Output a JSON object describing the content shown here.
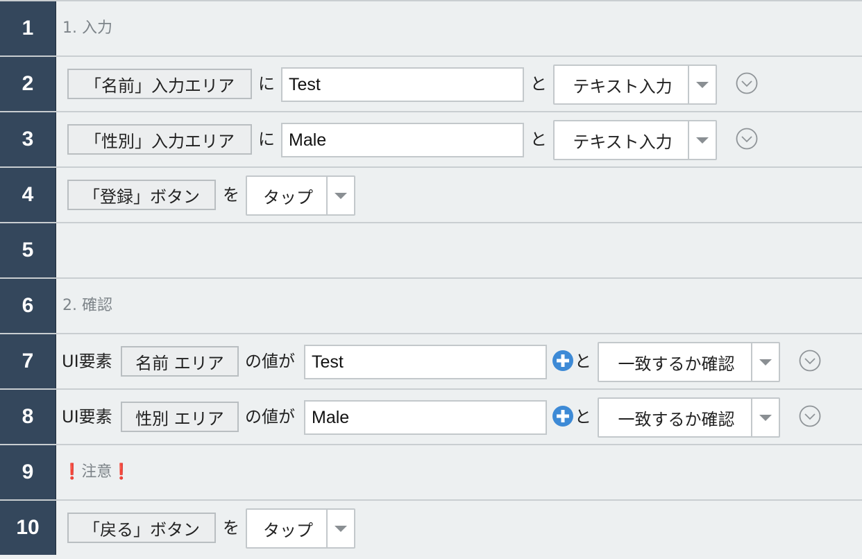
{
  "rows": [
    {
      "number": "1",
      "comment": "1. 入力"
    },
    {
      "number": "2",
      "element": "「名前」入力エリア",
      "particle": "に",
      "value": "Test",
      "connector": "と",
      "action": "テキスト入力"
    },
    {
      "number": "3",
      "element": "「性別」入力エリア",
      "particle": "に",
      "value": "Male",
      "connector": "と",
      "action": "テキスト入力"
    },
    {
      "number": "4",
      "element": "「登録」ボタン",
      "particle": "を",
      "action": "タップ"
    },
    {
      "number": "5"
    },
    {
      "number": "6",
      "comment": "2. 確認"
    },
    {
      "number": "7",
      "prefix": "UI要素",
      "element": "名前 エリア",
      "mid": "の値が",
      "value": "Test",
      "connector": "と",
      "action": "一致するか確認"
    },
    {
      "number": "8",
      "prefix": "UI要素",
      "element": "性別 エリア",
      "mid": "の値が",
      "value": "Male",
      "connector": "と",
      "action": "一致するか確認"
    },
    {
      "number": "9",
      "mark": "❗",
      "comment": "注意"
    },
    {
      "number": "10",
      "element": "「戻る」ボタン",
      "particle": "を",
      "action": "タップ"
    }
  ],
  "icons": {
    "dropdown": "chevron-down-circle-icon",
    "plus": "plus-circle-icon",
    "select_arrow": "triangle-down-icon",
    "warning": "exclamation-mark-icon"
  },
  "colors": {
    "number_bg": "#34475c",
    "row_bg": "#edf0f1",
    "plus_blue": "#3d8ad6",
    "warning_red": "#e01010"
  }
}
